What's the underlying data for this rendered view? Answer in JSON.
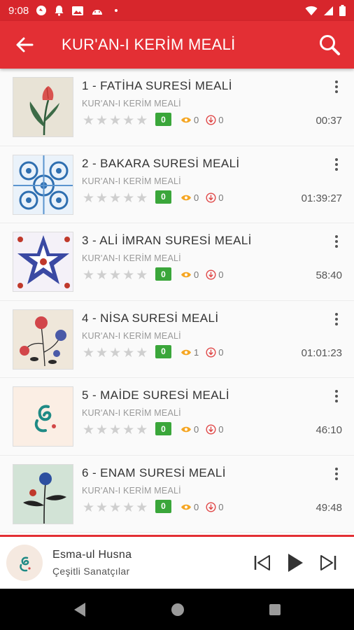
{
  "status_bar": {
    "time": "9:08"
  },
  "app_bar": {
    "title": "KUR'AN-I KERİM MEALİ"
  },
  "items": [
    {
      "title": "1 - FATİHA SURESİ MEALİ",
      "subtitle": "KUR'AN-I KERİM MEALİ",
      "rating": "0",
      "views": "0",
      "downloads": "0",
      "duration": "00:37",
      "thumb": "tulip"
    },
    {
      "title": "2 - BAKARA SURESİ MEALİ",
      "subtitle": "KUR'AN-I KERİM MEALİ",
      "rating": "0",
      "views": "0",
      "downloads": "0",
      "duration": "01:39:27",
      "thumb": "blue-tile"
    },
    {
      "title": "3 - ALİ İMRAN SURESİ MEALİ",
      "subtitle": "KUR'AN-I KERİM MEALİ",
      "rating": "0",
      "views": "0",
      "downloads": "0",
      "duration": "58:40",
      "thumb": "star-pattern"
    },
    {
      "title": "4 - NİSA SURESİ MEALİ",
      "subtitle": "KUR'AN-I KERİM MEALİ",
      "rating": "0",
      "views": "1",
      "downloads": "0",
      "duration": "01:01:23",
      "thumb": "flowers"
    },
    {
      "title": "5 - MAİDE SURESİ MEALİ",
      "subtitle": "KUR'AN-I KERİM MEALİ",
      "rating": "0",
      "views": "0",
      "downloads": "0",
      "duration": "46:10",
      "thumb": "calligraphy"
    },
    {
      "title": "6 - ENAM SURESİ MEALİ",
      "subtitle": "KUR'AN-I KERİM MEALİ",
      "rating": "0",
      "views": "0",
      "downloads": "0",
      "duration": "49:48",
      "thumb": "blue-flower"
    }
  ],
  "player": {
    "title": "Esma-ul Husna",
    "artist": "Çeşitli Sanatçılar"
  },
  "colors": {
    "primary": "#e32f34",
    "status": "#d7262c",
    "badge": "#3aa63a",
    "views_icon": "#f5a623",
    "download_icon": "#e04848"
  }
}
